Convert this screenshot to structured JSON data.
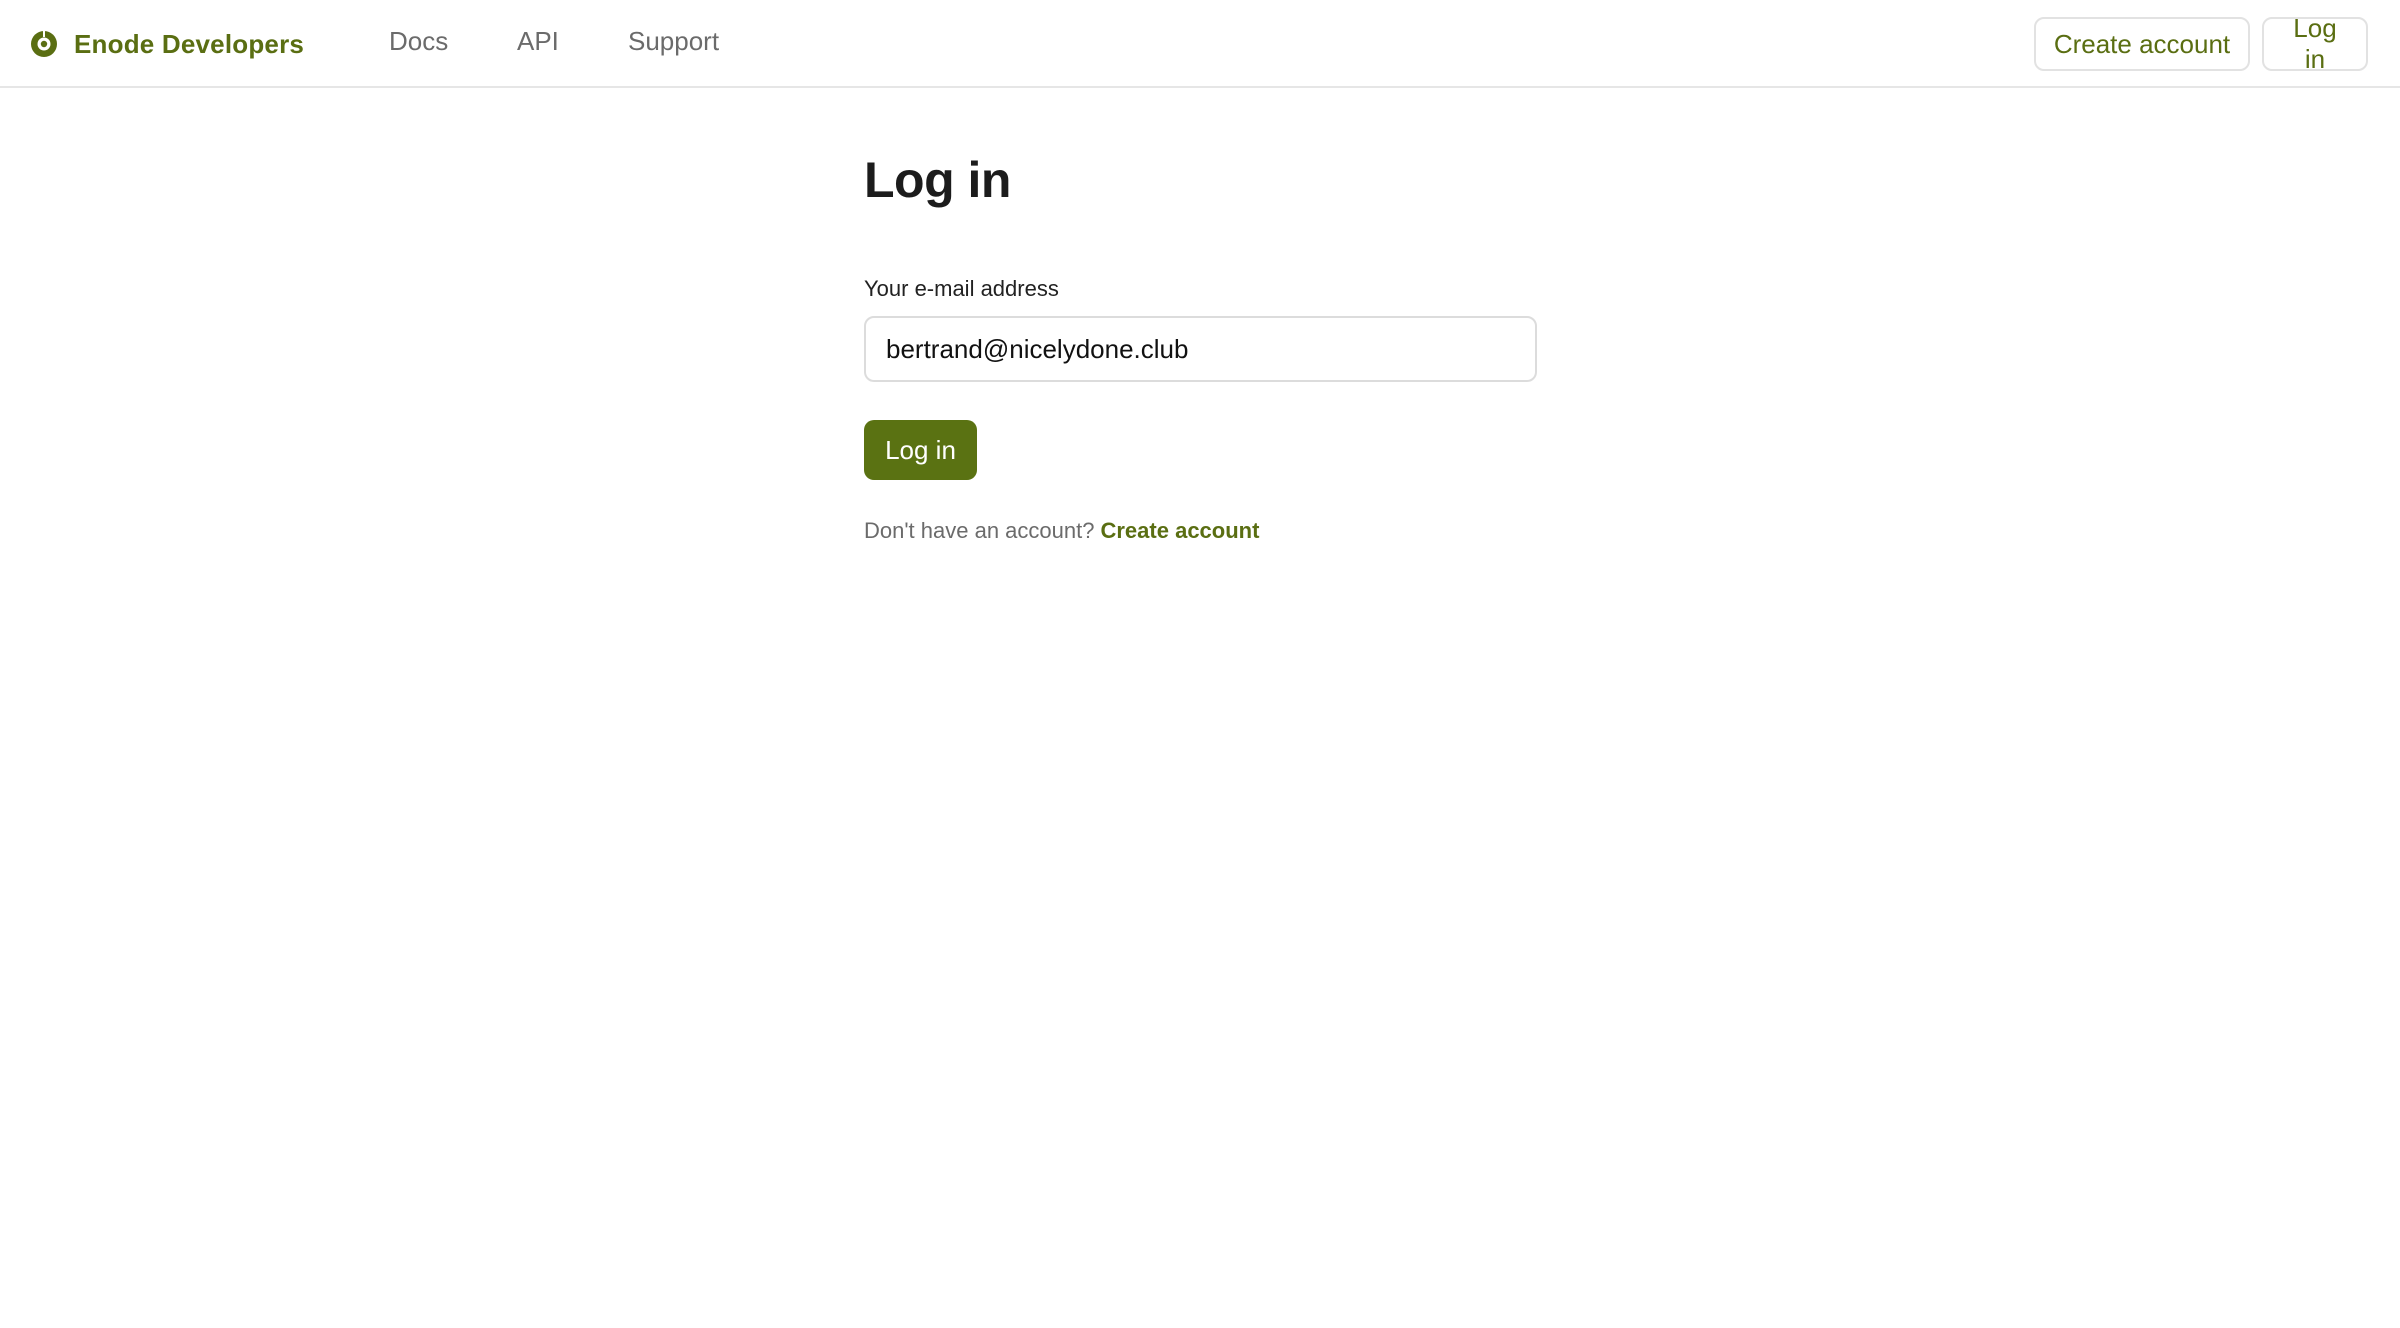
{
  "header": {
    "brand_name": "Enode Developers",
    "brand_icon": "enode-logo-icon",
    "nav": {
      "docs": "Docs",
      "api": "API",
      "support": "Support"
    },
    "create_account_label": "Create account",
    "login_label": "Log in"
  },
  "login_form": {
    "title": "Log in",
    "email_label": "Your e-mail address",
    "email_value": "bertrand@nicelydone.club",
    "submit_label": "Log in",
    "signup_prompt": "Don't have an account?",
    "signup_link": "Create account"
  },
  "colors": {
    "accent": "#5a7212",
    "accent_text": "#5a6e12",
    "muted_text": "#6b6b6b",
    "border": "#e2e2e2"
  }
}
